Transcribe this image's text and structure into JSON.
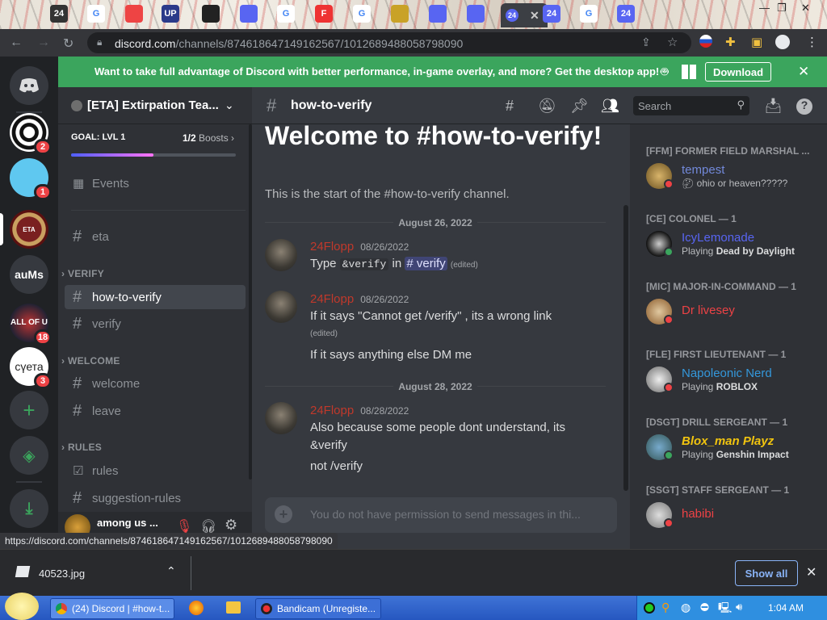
{
  "browser": {
    "tab_badges": [
      "24",
      "24",
      "24",
      "24"
    ],
    "active_tab_badge": "24",
    "url_host": "discord.com",
    "url_path": "/channels/874618647149162567/1012689488058798090",
    "status_url": "https://discord.com/channels/874618647149162567/1012689488058798090"
  },
  "banner": {
    "text": "Want to take full advantage of Discord with better performance, in-game overlay, and more? Get the desktop app!",
    "download_label": "Download"
  },
  "guilds": [
    {
      "label": "",
      "badge": "2"
    },
    {
      "label": "",
      "badge": "1"
    },
    {
      "label": "ETA",
      "badge": ""
    },
    {
      "label": "auMs",
      "badge": ""
    },
    {
      "label": "ALL OF U",
      "badge": "18"
    },
    {
      "label": "сүета",
      "badge": "3"
    }
  ],
  "server": {
    "name": "[ETA] Extirpation Tea...",
    "goal_label": "GOAL: LVL 1",
    "boosts": "1/2",
    "boosts_label": "Boosts",
    "boost_progress": 0.5,
    "events_label": "Events"
  },
  "channels": {
    "top": "eta",
    "cat_verify": "VERIFY",
    "verify_items": [
      "how-to-verify",
      "verify"
    ],
    "cat_welcome": "WELCOME",
    "welcome_items": [
      "welcome",
      "leave"
    ],
    "cat_rules": "RULES",
    "rules_items": [
      "rules",
      "suggestion-rules"
    ]
  },
  "user_panel": {
    "name": "among us ..."
  },
  "channel_header": {
    "title": "how-to-verify",
    "search_placeholder": "Search"
  },
  "intro": {
    "title": "Welcome to #how-to-verify!",
    "subtitle": "This is the start of the #how-to-verify channel."
  },
  "messages": {
    "date1": "August 26, 2022",
    "m1": {
      "author": "24Flopp",
      "time": "08/26/2022",
      "prefix": "Type",
      "code": "&verify",
      "in": "in",
      "mention": "verify",
      "edited": "(edited)"
    },
    "m2": {
      "author": "24Flopp",
      "time": "08/26/2022",
      "line1": "If it says \"Cannot get /verify\" ,  its a wrong link",
      "edited": "(edited)",
      "line2": "If it says anything else DM me"
    },
    "date2": "August 28, 2022",
    "m3": {
      "author": "24Flopp",
      "time": "08/28/2022",
      "line1": "Also because some people dont understand, its",
      "line2": "&verify",
      "line3": "not /verify"
    }
  },
  "composer": {
    "placeholder": "You do not have permission to send messages in thi..."
  },
  "members": [
    {
      "role": "[FFM] FORMER FIELD MARSHAL ...",
      "name": "tempest",
      "activity_prefix": "",
      "activity": "ohio or heaven?????",
      "name_color": "#7289da",
      "status_color": "#ed4245"
    },
    {
      "role": "[CE] COLONEL — 1",
      "name": "IcyLemonade",
      "activity_prefix": "Playing",
      "activity": "Dead by Daylight",
      "name_color": "#5865f2",
      "status_color": "#3ba55d"
    },
    {
      "role": "[MIC] MAJOR-IN-COMMAND — 1",
      "name": "Dr livesey",
      "activity_prefix": "",
      "activity": "",
      "name_color": "#ed4245",
      "status_color": "#ed4245"
    },
    {
      "role": "[FLE] FIRST LIEUTENANT — 1",
      "name": "Napoleonic Nerd",
      "activity_prefix": "Playing",
      "activity": "ROBLOX",
      "name_color": "#3498db",
      "status_color": "#ed4245"
    },
    {
      "role": "[DSGT] DRILL SERGEANT — 1",
      "name": "Blox_man Playz",
      "activity_prefix": "Playing",
      "activity": "Genshin Impact",
      "name_color": "#f1c40f",
      "status_color": "#3ba55d"
    },
    {
      "role": "[SSGT] STAFF SERGEANT — 1",
      "name": "habibi",
      "activity_prefix": "",
      "activity": "",
      "name_color": "#ed4245",
      "status_color": "#ed4245"
    }
  ],
  "downloads": {
    "file": "40523.jpg",
    "show_all": "Show all"
  },
  "taskbar": {
    "chrome_task": "(24) Discord | #how-t...",
    "bandicam_task": "Bandicam (Unregiste...",
    "clock": "1:04 AM"
  },
  "colors": {
    "accent": "#5865f2",
    "banner": "#3ba55d",
    "author": "#c0392b"
  }
}
